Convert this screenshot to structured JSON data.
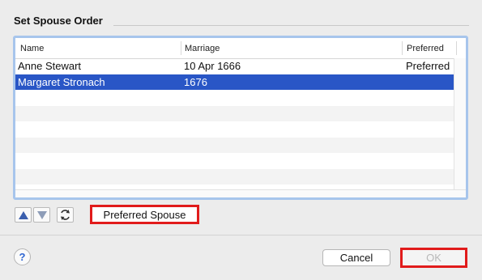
{
  "dialog": {
    "title": "Set Spouse Order"
  },
  "table": {
    "columns": [
      "Name",
      "Marriage",
      "Preferred"
    ],
    "rows": [
      {
        "name": "Anne Stewart",
        "marriage": "10 Apr 1666",
        "preferred": "Preferred",
        "selected": false
      },
      {
        "name": "Margaret Stronach",
        "marriage": "1676",
        "preferred": "",
        "selected": true
      }
    ],
    "empty_rows": 6
  },
  "controls": {
    "move_up_icon": "triangle-up-icon",
    "move_down_icon": "triangle-down-icon",
    "sort_icon": "refresh-sort-icon",
    "preferred_spouse_label": "Preferred Spouse"
  },
  "footer": {
    "help_label": "?",
    "cancel_label": "Cancel",
    "ok_label": "OK"
  },
  "colors": {
    "selection": "#2956c6",
    "highlight_box": "#e11b1b"
  }
}
